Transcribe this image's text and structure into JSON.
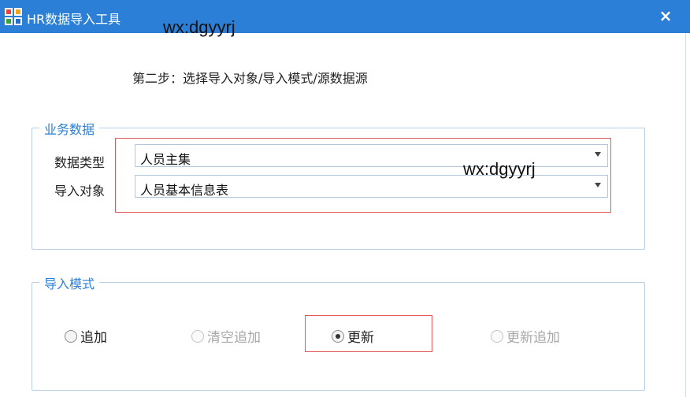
{
  "window": {
    "title": "HR数据导入工具",
    "close_glyph": "×",
    "accent_color": "#2b7fd6"
  },
  "watermarks": [
    "wx:dgyyrj",
    "wx:dgyyrj"
  ],
  "step_text": "第二步：选择导入对象/导入模式/源数据源",
  "business_group": {
    "title": "业务数据",
    "data_type": {
      "label": "数据类型",
      "value": "人员主集"
    },
    "import_object": {
      "label": "导入对象",
      "value": "人员基本信息表"
    }
  },
  "mode_group": {
    "title": "导入模式",
    "options": [
      {
        "label": "追加",
        "checked": false,
        "enabled": true
      },
      {
        "label": "清空追加",
        "checked": false,
        "enabled": false
      },
      {
        "label": "更新",
        "checked": true,
        "enabled": true
      },
      {
        "label": "更新追加",
        "checked": false,
        "enabled": false
      }
    ]
  },
  "highlight_color": "#e05a5a"
}
